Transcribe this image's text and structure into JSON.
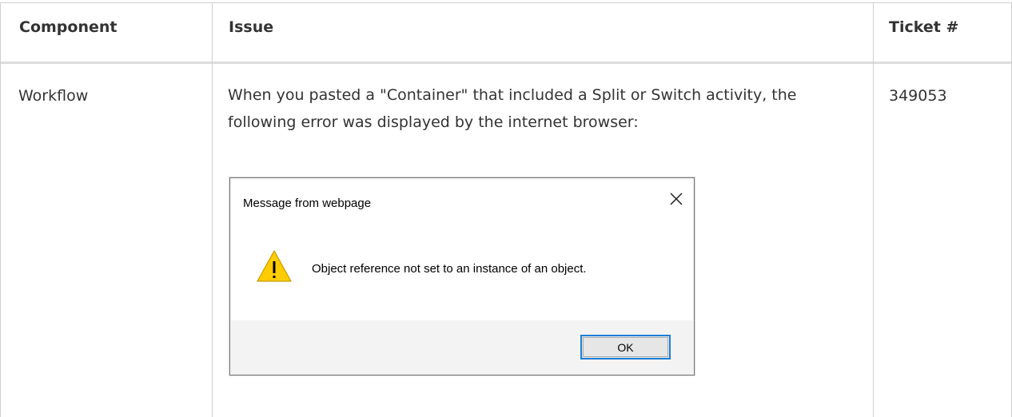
{
  "table": {
    "headers": {
      "component": "Component",
      "issue": "Issue",
      "ticket": "Ticket #"
    },
    "rows": [
      {
        "component": "Workflow",
        "issue": "When you pasted a \"Container\" that included a Split or Switch activity, the following error was displayed by the internet browser:",
        "ticket": "349053"
      }
    ]
  },
  "dialog": {
    "title": "Message from webpage",
    "message": "Object reference not set to an instance of an object.",
    "ok_label": "OK",
    "icons": {
      "close": "close-icon",
      "warning": "warning-icon"
    },
    "colors": {
      "warning_fill": "#ffcc00",
      "ok_border": "#1b7fd6"
    }
  }
}
